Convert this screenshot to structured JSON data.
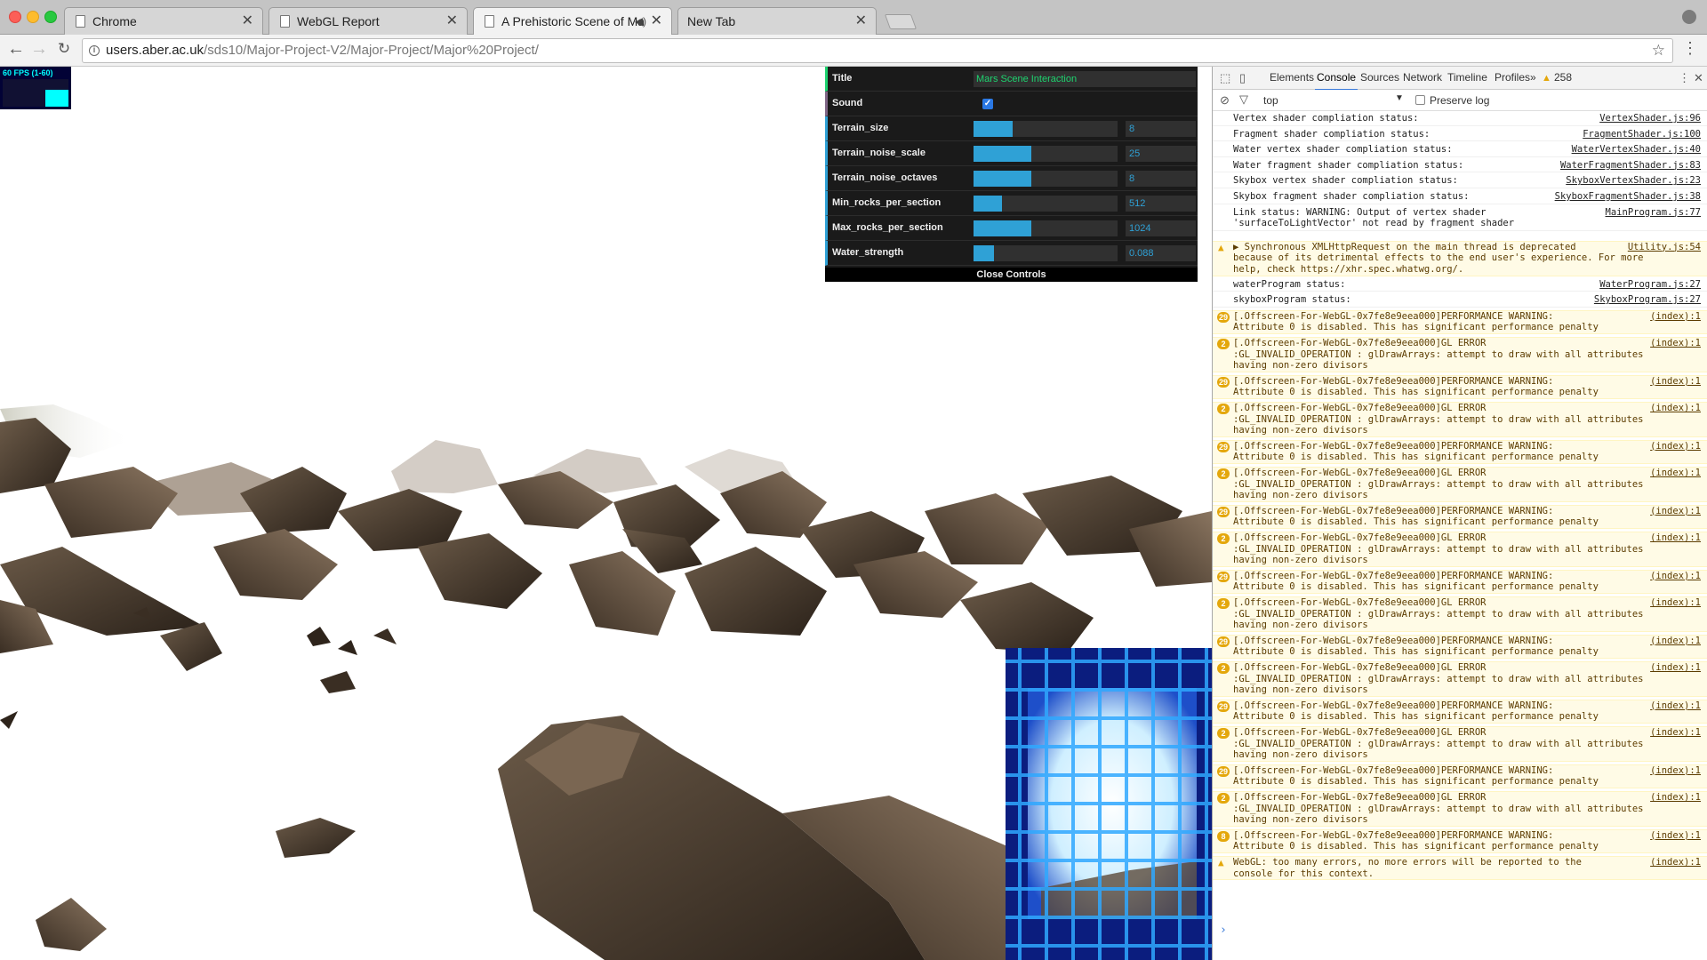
{
  "tabs": [
    {
      "title": "Chrome"
    },
    {
      "title": "WebGL Report"
    },
    {
      "title": "A Prehistoric Scene of Mars"
    },
    {
      "title": "New Tab"
    }
  ],
  "address": {
    "host": "users.aber.ac.uk",
    "path": "/sds10/Major-Project-V2/Major-Project/Major%20Project/"
  },
  "fps": {
    "label": "60 FPS (1-60)",
    "level": 0.6
  },
  "gui": {
    "title_label": "Title",
    "title_value": "Mars Scene Interaction",
    "sound_label": "Sound",
    "sound_checked": true,
    "sliders": [
      {
        "label": "Terrain_size",
        "value": "8",
        "fill": 0.27
      },
      {
        "label": "Terrain_noise_scale",
        "value": "25",
        "fill": 0.4
      },
      {
        "label": "Terrain_noise_octaves",
        "value": "8",
        "fill": 0.4
      },
      {
        "label": "Min_rocks_per_section",
        "value": "512",
        "fill": 0.2
      },
      {
        "label": "Max_rocks_per_section",
        "value": "1024",
        "fill": 0.4
      },
      {
        "label": "Water_strength",
        "value": "0.088",
        "fill": 0.14
      }
    ],
    "close_label": "Close Controls"
  },
  "devtools": {
    "tabs": [
      "Elements",
      "Console",
      "Sources",
      "Network",
      "Timeline",
      "Profiles"
    ],
    "more": "»",
    "warning_count": "258",
    "filter_context": "top",
    "preserve_log": "Preserve log"
  },
  "console": [
    {
      "type": "log",
      "text": "Vertex shader compliation status:",
      "src": "VertexShader.js:96"
    },
    {
      "type": "log",
      "text": "Fragment shader compliation status:",
      "src": "FragmentShader.js:100"
    },
    {
      "type": "log",
      "text": "Water vertex shader compliation status:",
      "src": "WaterVertexShader.js:40"
    },
    {
      "type": "log",
      "text": "Water fragment shader compliation status:",
      "src": "WaterFragmentShader.js:83"
    },
    {
      "type": "log",
      "text": "Skybox vertex shader compliation status:",
      "src": "SkyboxVertexShader.js:23"
    },
    {
      "type": "log",
      "text": "Skybox fragment shader compliation status:",
      "src": "SkyboxFragmentShader.js:38"
    },
    {
      "type": "log",
      "text": "Link status: WARNING: Output of vertex shader\n'surfaceToLightVector' not read by fragment shader",
      "src": "MainProgram.js:77"
    },
    {
      "type": "warn",
      "icon": "▲",
      "text": "▶ Synchronous XMLHttpRequest on the main thread is deprecated\nbecause of its detrimental effects to the end user's experience. For more\nhelp, check https://xhr.spec.whatwg.org/.",
      "src": "Utility.js:54"
    },
    {
      "type": "log",
      "text": "waterProgram status:",
      "src": "WaterProgram.js:27"
    },
    {
      "type": "log",
      "text": "skyboxProgram status:",
      "src": "SkyboxProgram.js:27"
    },
    {
      "type": "warn",
      "badge": "29",
      "text": "[.Offscreen-For-WebGL-0x7fe8e9eea000]PERFORMANCE WARNING:\nAttribute 0 is disabled. This has significant performance penalty",
      "src": "(index):1"
    },
    {
      "type": "warn",
      "badge": "2",
      "text": "[.Offscreen-For-WebGL-0x7fe8e9eea000]GL ERROR\n:GL_INVALID_OPERATION : glDrawArrays: attempt to draw with all attributes\nhaving non-zero divisors",
      "src": "(index):1"
    },
    {
      "type": "warn",
      "badge": "29",
      "text": "[.Offscreen-For-WebGL-0x7fe8e9eea000]PERFORMANCE WARNING:\nAttribute 0 is disabled. This has significant performance penalty",
      "src": "(index):1"
    },
    {
      "type": "warn",
      "badge": "2",
      "text": "[.Offscreen-For-WebGL-0x7fe8e9eea000]GL ERROR\n:GL_INVALID_OPERATION : glDrawArrays: attempt to draw with all attributes\nhaving non-zero divisors",
      "src": "(index):1"
    },
    {
      "type": "warn",
      "badge": "29",
      "text": "[.Offscreen-For-WebGL-0x7fe8e9eea000]PERFORMANCE WARNING:\nAttribute 0 is disabled. This has significant performance penalty",
      "src": "(index):1"
    },
    {
      "type": "warn",
      "badge": "2",
      "text": "[.Offscreen-For-WebGL-0x7fe8e9eea000]GL ERROR\n:GL_INVALID_OPERATION : glDrawArrays: attempt to draw with all attributes\nhaving non-zero divisors",
      "src": "(index):1"
    },
    {
      "type": "warn",
      "badge": "29",
      "text": "[.Offscreen-For-WebGL-0x7fe8e9eea000]PERFORMANCE WARNING:\nAttribute 0 is disabled. This has significant performance penalty",
      "src": "(index):1"
    },
    {
      "type": "warn",
      "badge": "2",
      "text": "[.Offscreen-For-WebGL-0x7fe8e9eea000]GL ERROR\n:GL_INVALID_OPERATION : glDrawArrays: attempt to draw with all attributes\nhaving non-zero divisors",
      "src": "(index):1"
    },
    {
      "type": "warn",
      "badge": "29",
      "text": "[.Offscreen-For-WebGL-0x7fe8e9eea000]PERFORMANCE WARNING:\nAttribute 0 is disabled. This has significant performance penalty",
      "src": "(index):1"
    },
    {
      "type": "warn",
      "badge": "2",
      "text": "[.Offscreen-For-WebGL-0x7fe8e9eea000]GL ERROR\n:GL_INVALID_OPERATION : glDrawArrays: attempt to draw with all attributes\nhaving non-zero divisors",
      "src": "(index):1"
    },
    {
      "type": "warn",
      "badge": "29",
      "text": "[.Offscreen-For-WebGL-0x7fe8e9eea000]PERFORMANCE WARNING:\nAttribute 0 is disabled. This has significant performance penalty",
      "src": "(index):1"
    },
    {
      "type": "warn",
      "badge": "2",
      "text": "[.Offscreen-For-WebGL-0x7fe8e9eea000]GL ERROR\n:GL_INVALID_OPERATION : glDrawArrays: attempt to draw with all attributes\nhaving non-zero divisors",
      "src": "(index):1"
    },
    {
      "type": "warn",
      "badge": "29",
      "text": "[.Offscreen-For-WebGL-0x7fe8e9eea000]PERFORMANCE WARNING:\nAttribute 0 is disabled. This has significant performance penalty",
      "src": "(index):1"
    },
    {
      "type": "warn",
      "badge": "2",
      "text": "[.Offscreen-For-WebGL-0x7fe8e9eea000]GL ERROR\n:GL_INVALID_OPERATION : glDrawArrays: attempt to draw with all attributes\nhaving non-zero divisors",
      "src": "(index):1"
    },
    {
      "type": "warn",
      "badge": "29",
      "text": "[.Offscreen-For-WebGL-0x7fe8e9eea000]PERFORMANCE WARNING:\nAttribute 0 is disabled. This has significant performance penalty",
      "src": "(index):1"
    },
    {
      "type": "warn",
      "badge": "2",
      "text": "[.Offscreen-For-WebGL-0x7fe8e9eea000]GL ERROR\n:GL_INVALID_OPERATION : glDrawArrays: attempt to draw with all attributes\nhaving non-zero divisors",
      "src": "(index):1"
    },
    {
      "type": "warn",
      "badge": "8",
      "text": "[.Offscreen-For-WebGL-0x7fe8e9eea000]PERFORMANCE WARNING:\nAttribute 0 is disabled. This has significant performance penalty",
      "src": "(index):1"
    },
    {
      "type": "warn",
      "icon": "▲",
      "text": "WebGL: too many errors, no more errors will be reported to the\nconsole for this context.",
      "src": "(index):1"
    }
  ],
  "colors": {
    "gui_text": "#1ed36f",
    "gui_number": "#2fa1d6",
    "console_warn_bg": "#fffbe6",
    "badge": "#e4a70b"
  }
}
